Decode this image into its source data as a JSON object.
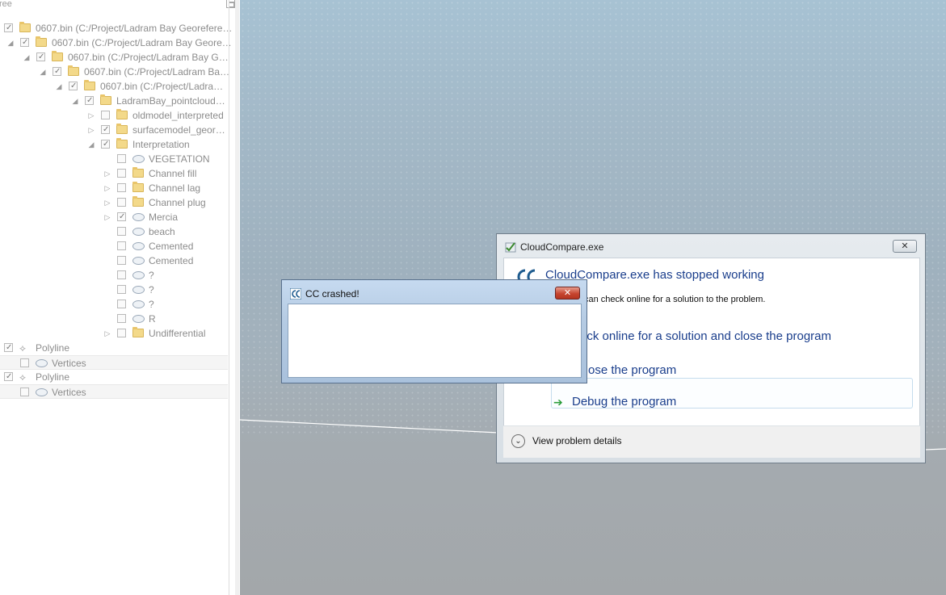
{
  "tree_panel": {
    "header_title": "ree",
    "items": [
      {
        "label": "0607.bin (C:/Project/Ladram Bay Georefere…",
        "checked": true,
        "icon": "folder-icon",
        "expander": ""
      },
      {
        "label": "0607.bin (C:/Project/Ladram Bay Geore…",
        "checked": true,
        "icon": "folder-icon",
        "expander": "◢"
      },
      {
        "label": "0607.bin (C:/Project/Ladram Bay G…",
        "checked": true,
        "icon": "folder-icon",
        "expander": "◢"
      },
      {
        "label": "0607.bin (C:/Project/Ladram Ba…",
        "checked": true,
        "icon": "folder-icon",
        "expander": "◢"
      },
      {
        "label": "0607.bin (C:/Project/Ladra…",
        "checked": true,
        "icon": "folder-icon",
        "expander": "◢"
      },
      {
        "label": "LadramBay_pointcloud…",
        "checked": true,
        "icon": "folder-icon",
        "expander": "◢"
      },
      {
        "label": "oldmodel_interpreted",
        "checked": false,
        "icon": "folder-icon",
        "expander": "▷"
      },
      {
        "label": "surfacemodel_geor…",
        "checked": true,
        "icon": "folder-icon",
        "expander": "▷"
      },
      {
        "label": "Interpretation",
        "checked": true,
        "icon": "folder-icon",
        "expander": "◢"
      },
      {
        "label": "VEGETATION",
        "checked": false,
        "icon": "cloud-icon",
        "expander": ""
      },
      {
        "label": "Channel fill",
        "checked": false,
        "icon": "folder-icon",
        "expander": "▷"
      },
      {
        "label": "Channel lag",
        "checked": false,
        "icon": "folder-icon",
        "expander": "▷"
      },
      {
        "label": "Channel plug",
        "checked": false,
        "icon": "folder-icon",
        "expander": "▷"
      },
      {
        "label": "Mercia",
        "checked": true,
        "icon": "cloud-icon",
        "expander": "▷"
      },
      {
        "label": "beach",
        "checked": false,
        "icon": "cloud-icon",
        "expander": ""
      },
      {
        "label": "Cemented",
        "checked": false,
        "icon": "cloud-icon",
        "expander": ""
      },
      {
        "label": "Cemented",
        "checked": false,
        "icon": "cloud-icon",
        "expander": ""
      },
      {
        "label": "?",
        "checked": false,
        "icon": "cloud-icon",
        "expander": ""
      },
      {
        "label": "?",
        "checked": false,
        "icon": "cloud-icon",
        "expander": ""
      },
      {
        "label": "?",
        "checked": false,
        "icon": "cloud-icon",
        "expander": ""
      },
      {
        "label": "R",
        "checked": false,
        "icon": "cloud-icon",
        "expander": ""
      },
      {
        "label": "Undifferential",
        "checked": false,
        "icon": "folder-icon",
        "expander": "▷"
      },
      {
        "label": "Polyline",
        "checked": true,
        "icon": "polyline-icon",
        "expander": ""
      },
      {
        "label": "Vertices",
        "checked": false,
        "icon": "cloud-icon",
        "expander": ""
      },
      {
        "label": "Polyline",
        "checked": true,
        "icon": "polyline-icon",
        "expander": ""
      },
      {
        "label": "Vertices",
        "checked": false,
        "icon": "cloud-icon",
        "expander": ""
      }
    ]
  },
  "error_dialog": {
    "title": "CloudCompare.exe",
    "close_label": "✕",
    "headline": "CloudCompare.exe has stopped working",
    "subtext": "can check online for a solution to the problem.",
    "option_check_online": "eck online for a solution and close the program",
    "option_close": "ose the program",
    "option_debug": "Debug the program",
    "debug_arrow": "➔",
    "details_chevron": "⌄",
    "details_label": "View problem details"
  },
  "cc_dialog": {
    "title": "CC crashed!",
    "close_label": "✕"
  },
  "colors": {
    "link_blue": "#1a3e8c",
    "arrow_green": "#2a9d3a",
    "close_red": "#c6452f"
  }
}
